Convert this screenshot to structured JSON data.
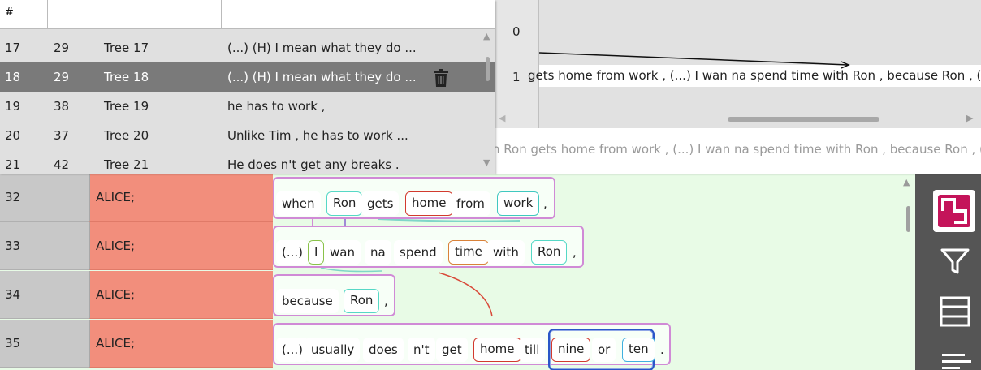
{
  "list": {
    "headers": [
      "#",
      "",
      "",
      ""
    ],
    "rows": [
      {
        "num": "17",
        "line": "29",
        "name": "Tree 17",
        "text": "(...) (H) I mean what they do ..."
      },
      {
        "num": "18",
        "line": "29",
        "name": "Tree 18",
        "text": "(...) (H) I mean what they do ...",
        "selected": true
      },
      {
        "num": "19",
        "line": "38",
        "name": "Tree 19",
        "text": "he has to work ,"
      },
      {
        "num": "20",
        "line": "37",
        "name": "Tree 20",
        "text": "Unlike Tim , he has to work ..."
      },
      {
        "num": "21",
        "line": "42",
        "name": "Tree 21",
        "text": "He does n't get any breaks ."
      }
    ]
  },
  "tree": {
    "levels": [
      "0",
      "1"
    ],
    "leaf_text": "gets home from work , (...) I wan na spend time with Ron , because Ron , (...)",
    "preview_text": "n Ron gets home from work , (...) I wan na spend time with Ron , because Ron , (...)"
  },
  "lines": [
    {
      "num": "32",
      "speaker": "ALICE;",
      "tokens": [
        "when",
        "Ron",
        "gets",
        "home",
        "from",
        "work",
        ","
      ]
    },
    {
      "num": "33",
      "speaker": "ALICE;",
      "tokens": [
        "(...)",
        "I",
        "wan",
        "na",
        "spend",
        "time",
        "with",
        "Ron",
        ","
      ]
    },
    {
      "num": "34",
      "speaker": "ALICE;",
      "tokens": [
        "because",
        "Ron",
        ","
      ]
    },
    {
      "num": "35",
      "speaker": "ALICE;",
      "tokens": [
        "(...)",
        "usually",
        "does",
        "n't",
        "get",
        "home",
        "till",
        "nine",
        "or",
        "ten",
        "."
      ]
    }
  ],
  "toolbar": {
    "icons": [
      "app-logo-icon",
      "filter-icon",
      "table-view-icon",
      "text-align-icon"
    ]
  },
  "colors": {
    "selected_row": "#7a7a7a",
    "speaker_cell": "#f28e7c",
    "transcript_bg": "#e8fbe6",
    "toolbar_bg": "#555555",
    "logo_accent": "#c4145a",
    "group_border": "#2a56c8"
  }
}
